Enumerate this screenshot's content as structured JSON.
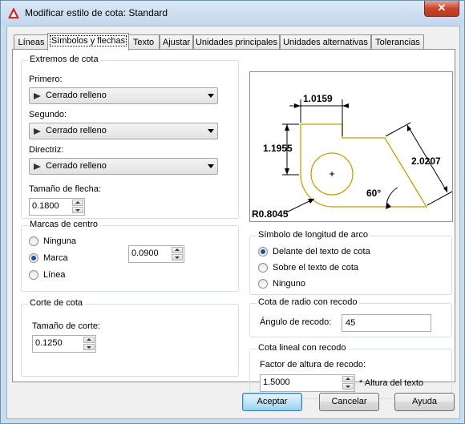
{
  "window": {
    "title": "Modificar estilo de cota: Standard",
    "close_label": "✕"
  },
  "tabs": [
    {
      "label": "Líneas"
    },
    {
      "label": "Símbolos y flechas"
    },
    {
      "label": "Texto"
    },
    {
      "label": "Ajustar"
    },
    {
      "label": "Unidades principales"
    },
    {
      "label": "Unidades alternativas"
    },
    {
      "label": "Tolerancias"
    }
  ],
  "arrowheads": {
    "group_label": "Extremos de cota",
    "first_label": "Primero:",
    "first_value": "Cerrado relleno",
    "second_label": "Segundo:",
    "second_value": "Cerrado relleno",
    "leader_label": "Directriz:",
    "leader_value": "Cerrado relleno",
    "size_label": "Tamaño de flecha:",
    "size_value": "0.1800"
  },
  "center_marks": {
    "group_label": "Marcas de centro",
    "options": [
      "Ninguna",
      "Marca",
      "Línea"
    ],
    "selected": "Marca",
    "size_value": "0.0900"
  },
  "dim_break": {
    "group_label": "Corte de cota",
    "size_label": "Tamaño de corte:",
    "size_value": "0.1250"
  },
  "preview": {
    "dim_top": "1.0159",
    "dim_left": "1.1955",
    "dim_right": "2.0207",
    "angle": "60°",
    "radius": "R0.8045",
    "center_mark": "+"
  },
  "arc_length": {
    "group_label": "Símbolo de longitud de arco",
    "options": [
      "Delante del texto de cota",
      "Sobre el texto de cota",
      "Ninguno"
    ],
    "selected": "Delante del texto de cota"
  },
  "radius_jog": {
    "group_label": "Cota de radio con recodo",
    "angle_label": "Ángulo de recodo:",
    "angle_value": "45"
  },
  "linear_jog": {
    "group_label": "Cota lineal con recodo",
    "factor_label": "Factor de altura de recodo:",
    "factor_value": "1.5000",
    "factor_suffix": "* Altura del texto"
  },
  "buttons": {
    "ok": "Aceptar",
    "cancel": "Cancelar",
    "help": "Ayuda"
  },
  "colors": {
    "preview_shape": "#c8a000",
    "preview_dims": "#000000"
  }
}
